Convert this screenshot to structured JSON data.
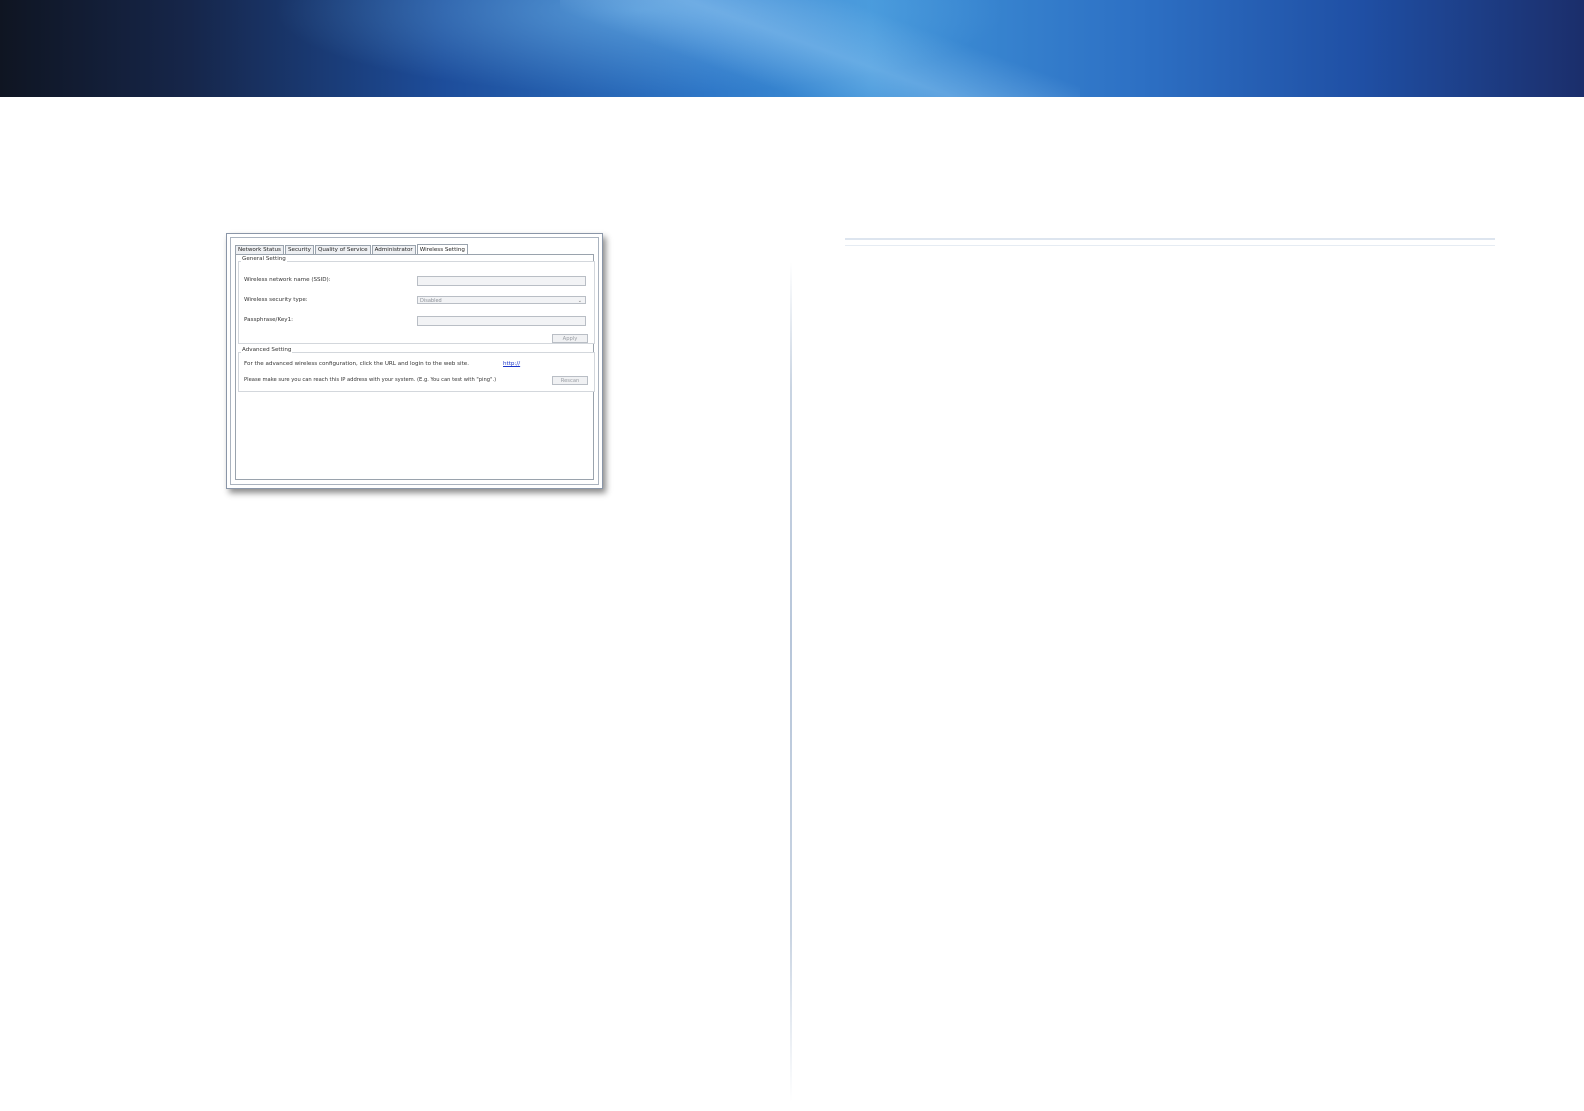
{
  "dialog": {
    "tabs": [
      {
        "label": "Network Status"
      },
      {
        "label": "Security"
      },
      {
        "label": "Quality of Service"
      },
      {
        "label": "Administrator"
      },
      {
        "label": "Wireless Setting"
      }
    ],
    "active_tab": "Wireless Setting",
    "general": {
      "title": "General Setting",
      "ssid_label": "Wireless network name (SSID):",
      "ssid_value": "",
      "security_label": "Wireless security type:",
      "security_value": "Disabled",
      "passphrase_label": "Passphrase/Key1:",
      "passphrase_value": "",
      "apply_label": "Apply"
    },
    "advanced": {
      "title": "Advanced Setting",
      "info_text": "For the advanced wireless configuration, click the URL and login to the web site.",
      "url": "http://",
      "ping_text": "Please make sure you can reach this IP address with your system. (E.g. You can test with \"ping\".)",
      "rescan_label": "Rescan"
    }
  }
}
